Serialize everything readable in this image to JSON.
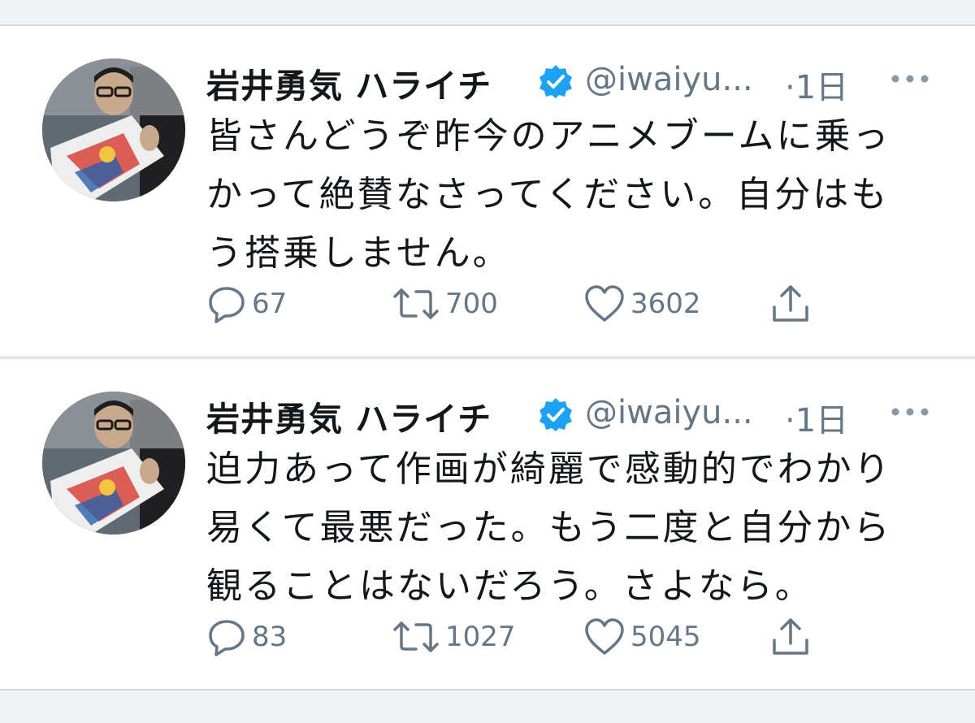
{
  "tweets": [
    {
      "author_name": "岩井勇気 ハライチ",
      "handle": "@iwaiyu...",
      "time": "·1日",
      "lines": [
        "皆さんどうぞ昨今のアニメブームに乗っ",
        "かって絶賛なさってください。自分はも",
        "う搭乗しません。"
      ],
      "reply_count": "67",
      "retweet_count": "700",
      "like_count": "3602"
    },
    {
      "author_name": "岩井勇気 ハライチ",
      "handle": "@iwaiyu...",
      "time": "·1日",
      "lines": [
        "迫力あって作画が綺麗で感動的でわかり",
        "易くて最悪だった。もう二度と自分から",
        "観ることはないだろう。さよなら。"
      ],
      "reply_count": "83",
      "retweet_count": "1027",
      "like_count": "5045"
    }
  ],
  "icons": {
    "verified": "verified-badge-icon",
    "more": "more-options-icon",
    "reply": "reply-icon",
    "retweet": "retweet-icon",
    "like": "heart-icon",
    "share": "share-icon"
  },
  "colors": {
    "verified_blue": "#1da1f2",
    "secondary_text": "#657786",
    "primary_text": "#14171a"
  }
}
